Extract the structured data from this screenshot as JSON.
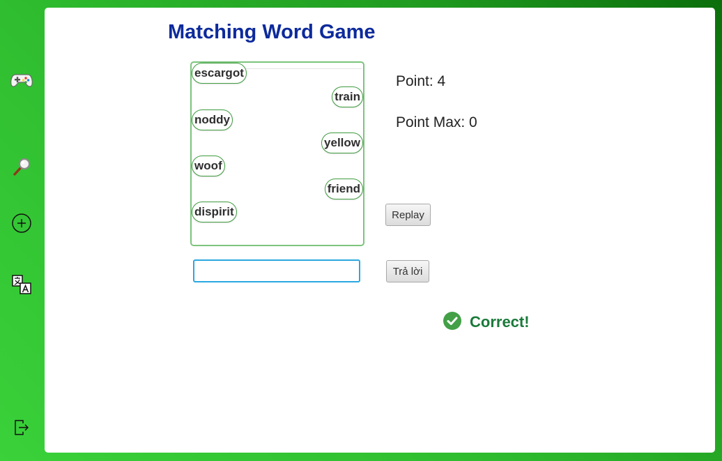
{
  "colors": {
    "sidebar_gradient_start": "#3ad13a",
    "sidebar_gradient_end": "#0b6e0b",
    "title": "#0d2a9c",
    "word_border": "#3f9c3f",
    "input_border": "#2aa8e0",
    "correct_text": "#1a7a3a",
    "correct_icon": "#43a047"
  },
  "sidebar": {
    "items": [
      {
        "icon": "gamepad-icon"
      },
      {
        "icon": "search-icon"
      },
      {
        "icon": "add-circle-icon"
      },
      {
        "icon": "translate-icon"
      },
      {
        "icon": "logout-icon"
      }
    ]
  },
  "game": {
    "title": "Matching Word Game",
    "words": [
      {
        "text": "escargot",
        "side": "left"
      },
      {
        "text": "train",
        "side": "right"
      },
      {
        "text": "noddy",
        "side": "left"
      },
      {
        "text": "yellow",
        "side": "right"
      },
      {
        "text": "woof",
        "side": "left"
      },
      {
        "text": "friend",
        "side": "right"
      },
      {
        "text": "dispirit",
        "side": "left"
      }
    ],
    "point_label": "Point: 4",
    "point_max_label": "Point Max: 0",
    "replay_label": "Replay",
    "answer_value": "",
    "answer_placeholder": "",
    "submit_label": "Trả lời",
    "result_text": "Correct!",
    "result_icon": "check-circle-icon"
  }
}
